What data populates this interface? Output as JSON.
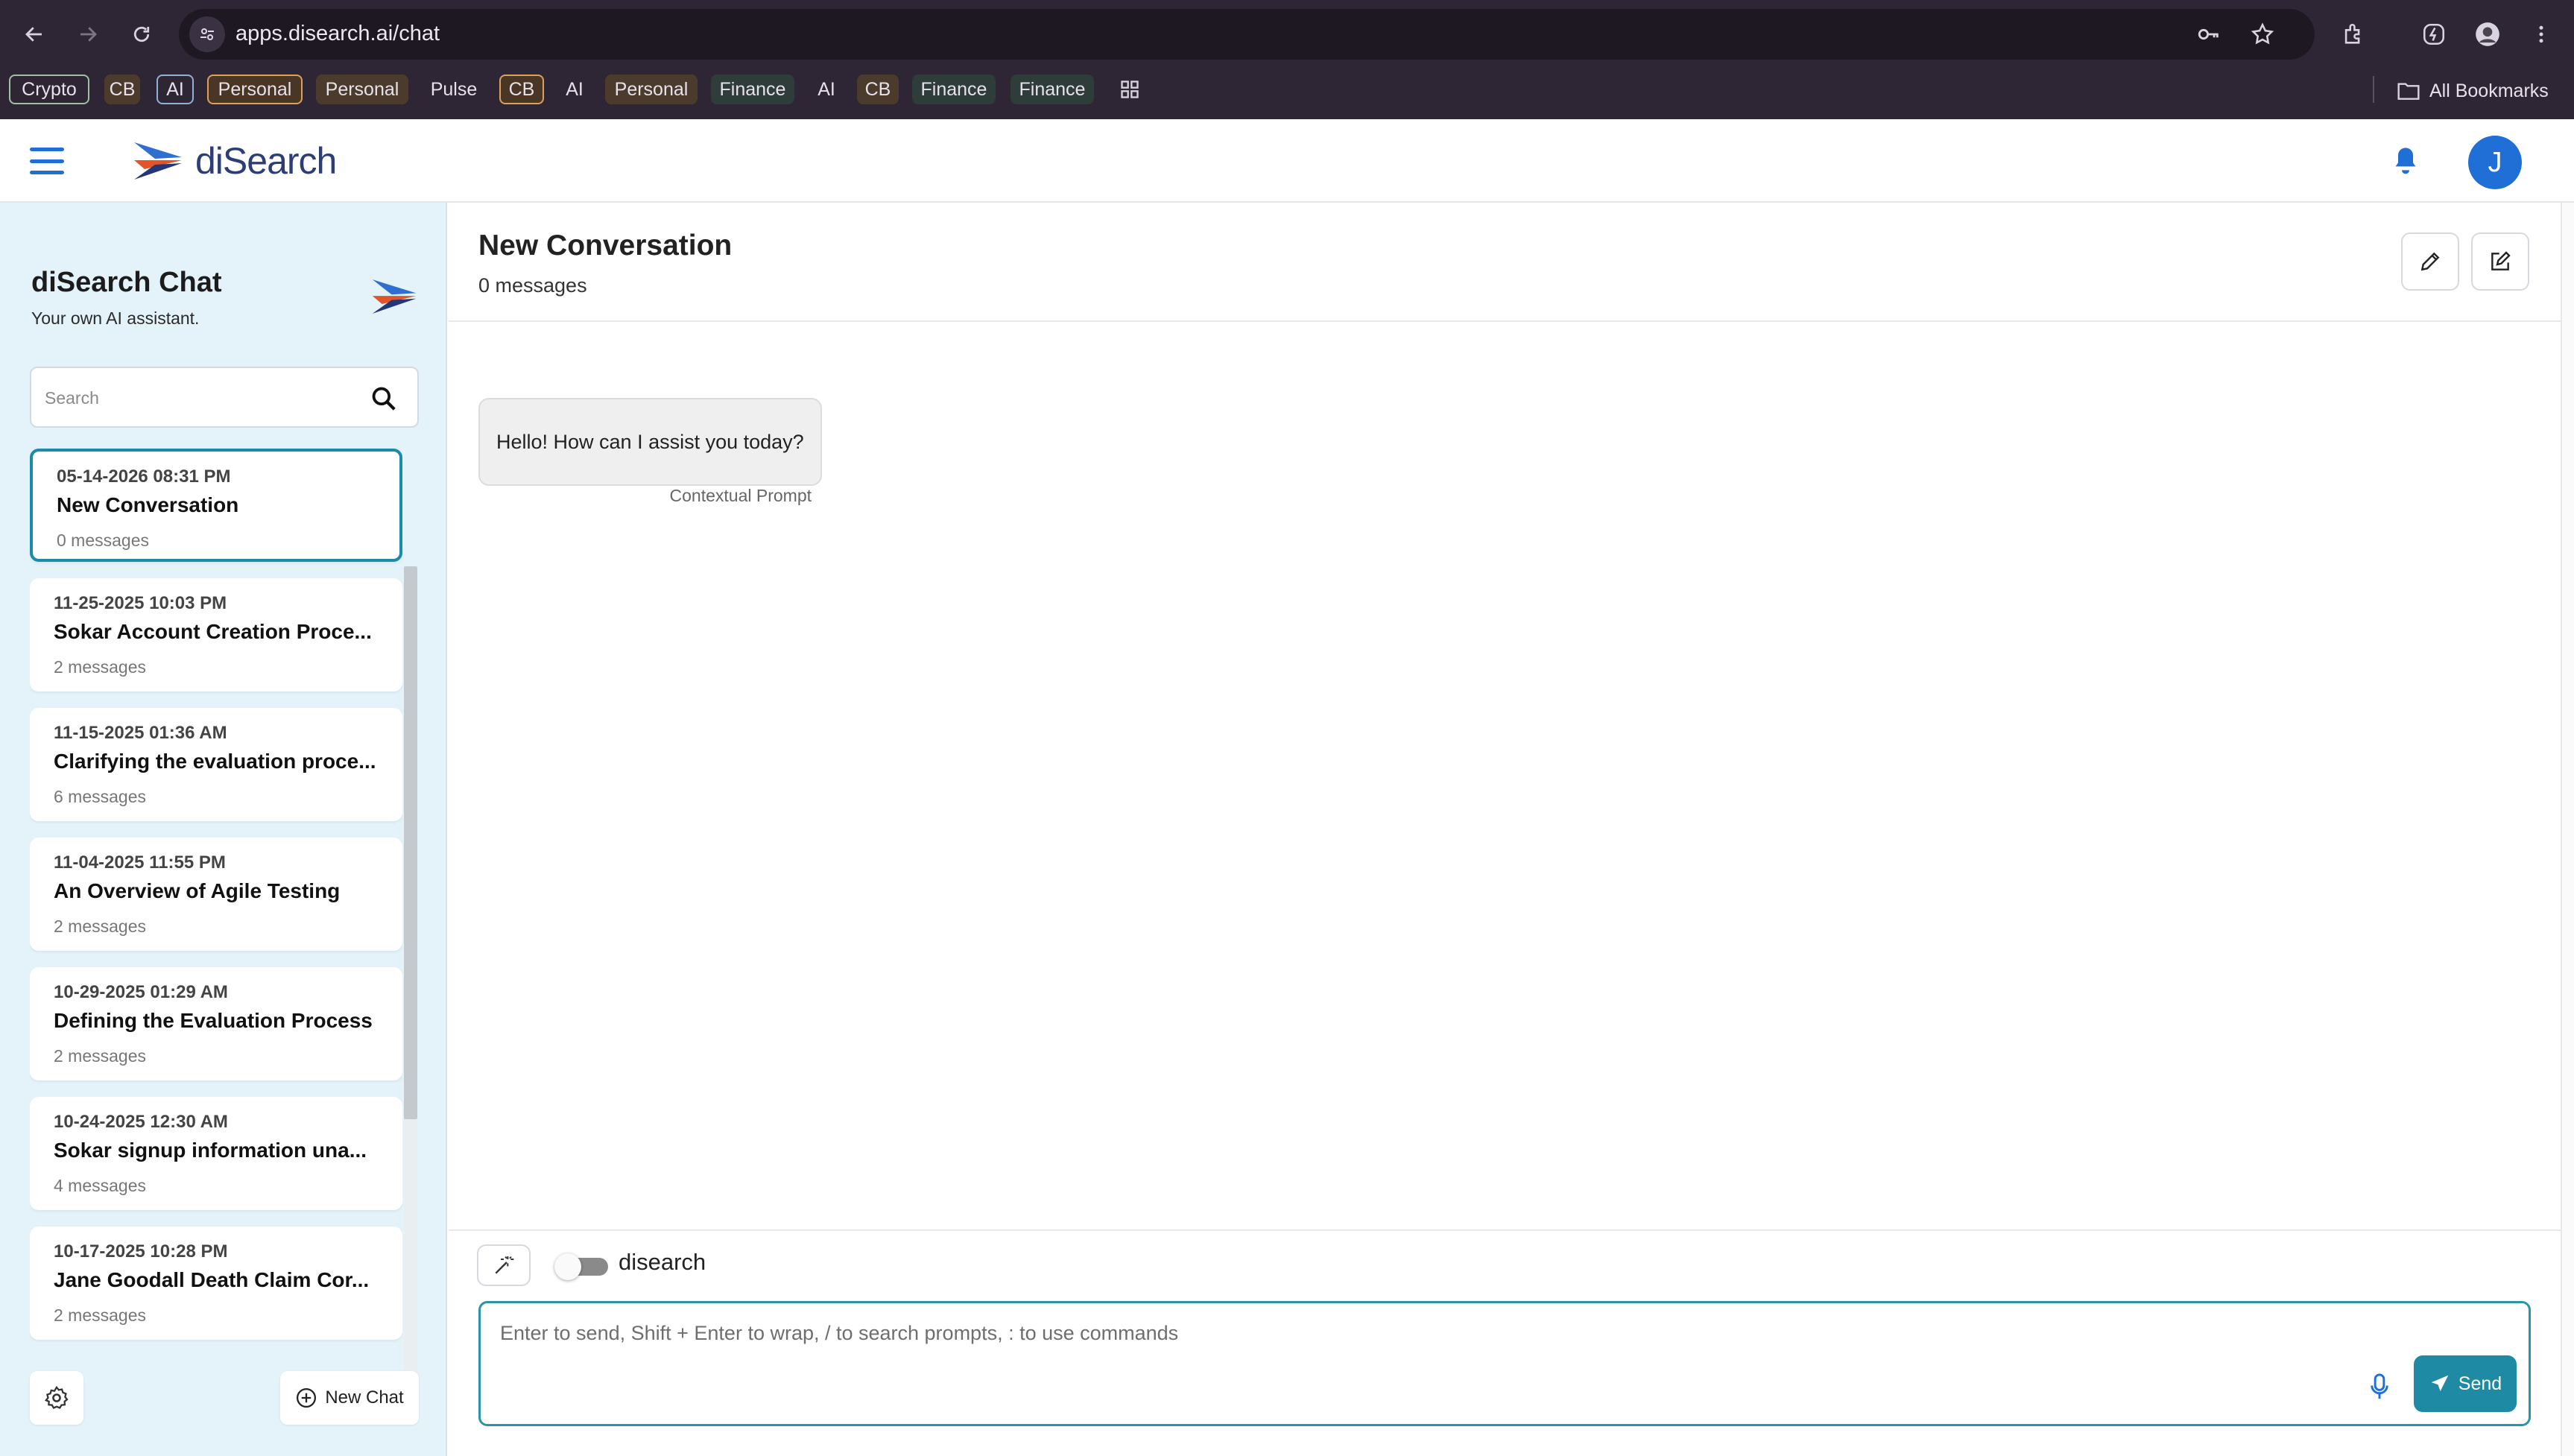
{
  "browser": {
    "url": "apps.disearch.ai/chat",
    "bookmarks": [
      "Crypto",
      "CB",
      "AI",
      "Personal",
      "Personal",
      "Pulse",
      "CB",
      "AI",
      "Personal",
      "Finance",
      "AI",
      "CB",
      "Finance",
      "Finance"
    ],
    "all_bookmarks_label": "All Bookmarks"
  },
  "app": {
    "brand": "diSearch",
    "avatar_initial": "J"
  },
  "sidebar": {
    "title": "diSearch Chat",
    "subtitle": "Your own AI assistant.",
    "search_placeholder": "Search",
    "conversations": [
      {
        "date": "05-14-2026 08:31 PM",
        "title": "New Conversation",
        "count": "0 messages"
      },
      {
        "date": "11-25-2025 10:03 PM",
        "title": "Sokar Account Creation Proce...",
        "count": "2 messages"
      },
      {
        "date": "11-15-2025 01:36 AM",
        "title": "Clarifying the evaluation proce...",
        "count": "6 messages"
      },
      {
        "date": "11-04-2025 11:55 PM",
        "title": "An Overview of Agile Testing",
        "count": "2 messages"
      },
      {
        "date": "10-29-2025 01:29 AM",
        "title": "Defining the Evaluation Process",
        "count": "2 messages"
      },
      {
        "date": "10-24-2025 12:30 AM",
        "title": "Sokar signup information una...",
        "count": "4 messages"
      },
      {
        "date": "10-17-2025 10:28 PM",
        "title": "Jane Goodall Death Claim Cor...",
        "count": "2 messages"
      }
    ],
    "new_chat_label": "New Chat"
  },
  "conversation": {
    "title": "New Conversation",
    "count": "0 messages",
    "greeting": "Hello! How can I assist you today?",
    "greeting_caption": "Contextual Prompt"
  },
  "composer": {
    "toggle_label": "disearch",
    "toggle_on": false,
    "placeholder": "Enter to send, Shift + Enter to wrap, / to search prompts, : to use commands",
    "send_label": "Send"
  },
  "colors": {
    "accent": "#1f8aa3",
    "brand_blue": "#1f6fd6",
    "sidebar_bg": "#e4f3fa"
  }
}
